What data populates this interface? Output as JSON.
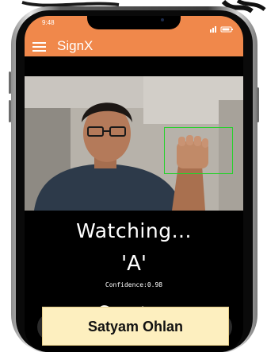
{
  "status_bar": {
    "time": "9:48"
  },
  "app_bar": {
    "title": "SignX",
    "menu_icon": "hamburger-menu-icon"
  },
  "camera": {
    "detection_color": "#26d12c"
  },
  "recognition": {
    "status": "Watching...",
    "letter": "'A'",
    "confidence": "Confidence:0.98",
    "feedback_visible": "Gre",
    "feedback_faded": "at"
  },
  "caption": {
    "name": "Satyam Ohlan"
  },
  "colors": {
    "accent": "#f0884b",
    "background": "#000000",
    "badge": "#fdefbf"
  }
}
